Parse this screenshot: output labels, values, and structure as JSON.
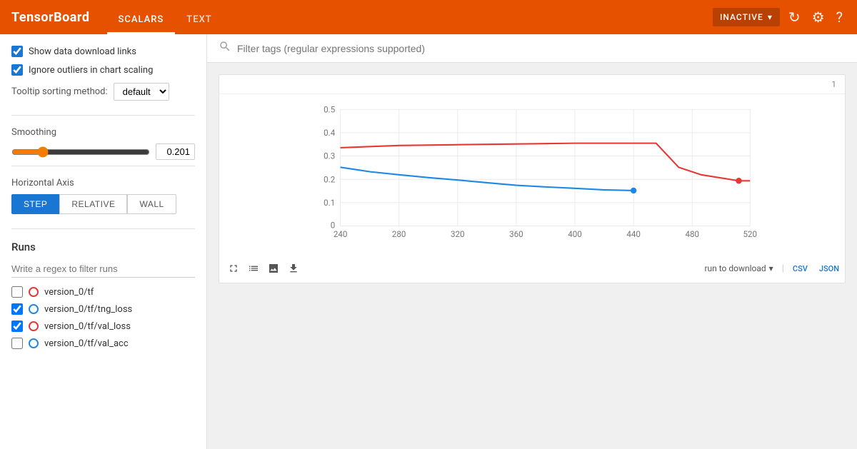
{
  "topbar": {
    "logo": "TensorBoard",
    "nav_items": [
      {
        "label": "SCALARS",
        "active": true
      },
      {
        "label": "TEXT",
        "active": false
      }
    ],
    "status": "INACTIVE",
    "icons": {
      "refresh": "↻",
      "settings": "⚙",
      "help": "?"
    }
  },
  "sidebar": {
    "show_download_label": "Show data download links",
    "ignore_outliers_label": "Ignore outliers in chart scaling",
    "tooltip_label": "Tooltip sorting method:",
    "tooltip_value": "default",
    "smoothing_label": "Smoothing",
    "smoothing_value": "0.201",
    "horizontal_axis_label": "Horizontal Axis",
    "axis_buttons": [
      {
        "label": "STEP",
        "active": true
      },
      {
        "label": "RELATIVE",
        "active": false
      },
      {
        "label": "WALL",
        "active": false
      }
    ],
    "runs_label": "Runs",
    "runs_filter_placeholder": "Write a regex to filter runs",
    "runs": [
      {
        "name": "version_0/tf",
        "checked": false,
        "color": "#E53935",
        "border_color": "#E53935"
      },
      {
        "name": "version_0/tf/tng_loss",
        "checked": true,
        "color": "#1E88E5",
        "border_color": "#1E88E5"
      },
      {
        "name": "version_0/tf/val_loss",
        "checked": true,
        "color": "#E53935",
        "border_color": "#E53935"
      },
      {
        "name": "version_0/tf/val_acc",
        "checked": false,
        "color": "#1E88E5",
        "border_color": "#1E88E5"
      }
    ]
  },
  "search": {
    "placeholder": "Filter tags (regular expressions supported)"
  },
  "chart": {
    "card_number": "1",
    "run_to_download_label": "run to download",
    "csv_label": "CSV",
    "json_label": "JSON",
    "y_axis": [
      0.5,
      0.4,
      0.3,
      0.2,
      0.1,
      0
    ],
    "x_axis": [
      240,
      280,
      320,
      360,
      400,
      440,
      480,
      520
    ]
  }
}
